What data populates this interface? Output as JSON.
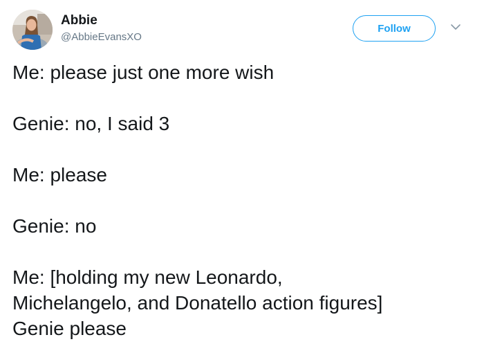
{
  "user": {
    "display_name": "Abbie",
    "handle": "@AbbieEvansXO"
  },
  "actions": {
    "follow_label": "Follow",
    "menu_icon": "chevron-down-icon"
  },
  "colors": {
    "accent": "#1da1f2",
    "text": "#14171a",
    "secondary_text": "#657786"
  },
  "tweet": {
    "paragraphs": [
      [
        "Me: please just one more wish"
      ],
      [
        "Genie: no, I said 3"
      ],
      [
        "Me: please"
      ],
      [
        "Genie: no"
      ],
      [
        "Me: [holding my new Leonardo,",
        "Michelangelo, and Donatello action figures]",
        "Genie please"
      ]
    ]
  }
}
